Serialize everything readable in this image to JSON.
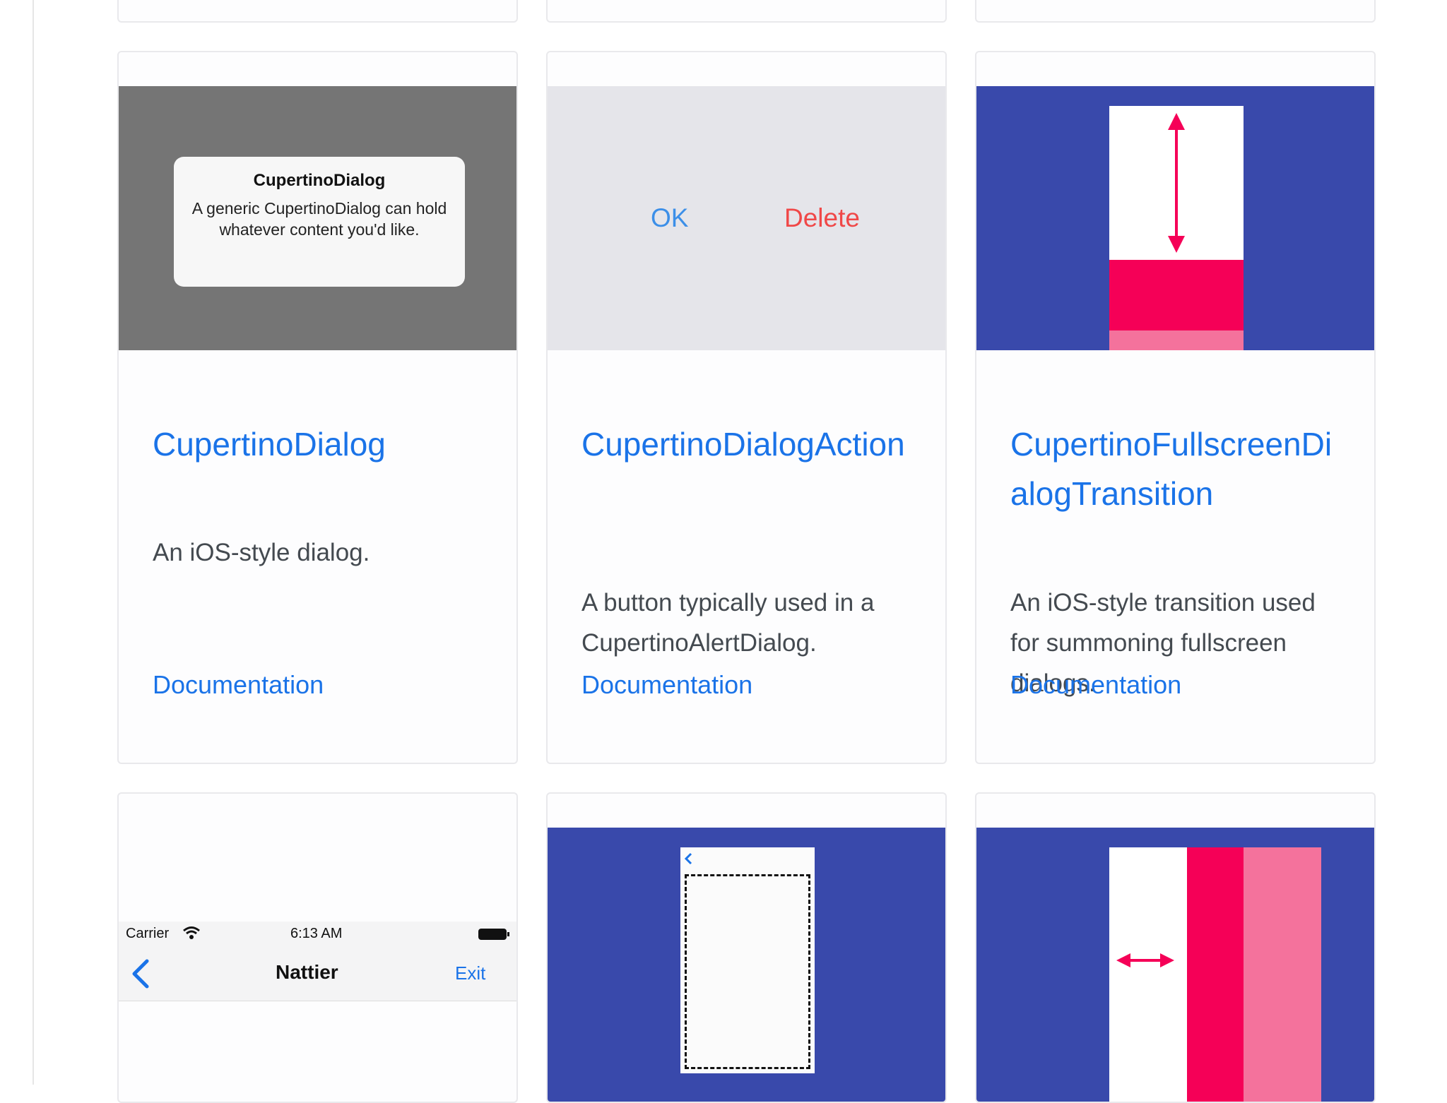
{
  "cards": [
    {
      "title": "CupertinoDialog",
      "description": "An iOS-style dialog.",
      "doc_link": "Documentation",
      "preview": {
        "dialog_title": "CupertinoDialog",
        "dialog_body": "A generic CupertinoDialog can hold whatever content you'd like.",
        "background": "#757575"
      }
    },
    {
      "title": "CupertinoDialogAction",
      "description": "A button typically used in a CupertinoAlertDialog.",
      "doc_link": "Documentation",
      "preview": {
        "ok_label": "OK",
        "delete_label": "Delete",
        "background": "#e5e5ea",
        "ok_color": "#3c8fe8",
        "delete_color": "#f04848"
      }
    },
    {
      "title": "CupertinoFullscreenDialogTransition",
      "description": "An iOS-style transition used for summoning fullscreen dialogs.",
      "doc_link": "Documentation",
      "preview": {
        "background": "#3949ab",
        "accent": "#f50057",
        "accent_light": "#f4729c"
      }
    }
  ],
  "bottom_cards": [
    {
      "preview": {
        "carrier": "Carrier",
        "time": "6:13 AM",
        "nav_title": "Nattier",
        "exit_label": "Exit",
        "icons": [
          "wifi-icon",
          "battery-icon",
          "back-chevron-icon"
        ]
      }
    },
    {
      "preview": {
        "background": "#3949ab"
      }
    },
    {
      "preview": {
        "background": "#3949ab",
        "accent": "#f50057",
        "accent_light": "#f4729c"
      }
    }
  ]
}
